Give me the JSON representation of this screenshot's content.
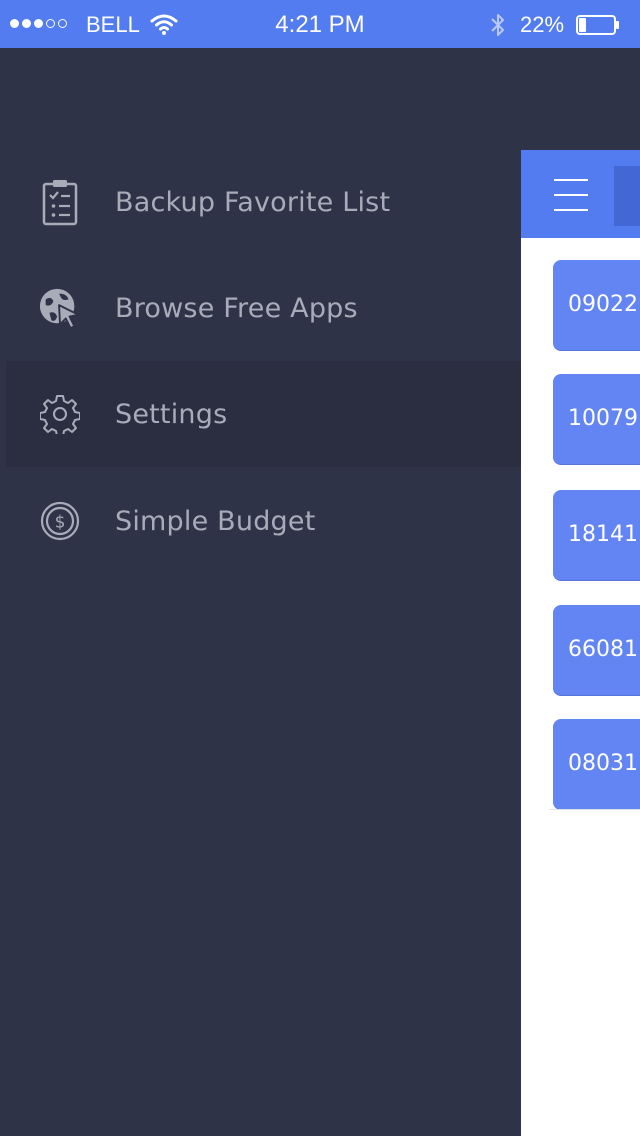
{
  "status_bar": {
    "signal_strength": 3,
    "signal_max": 5,
    "carrier": "BELL",
    "time": "4:21 PM",
    "battery_percent_label": "22%",
    "battery_level": 0.22
  },
  "menu": {
    "items": [
      {
        "label": "Backup Favorite List",
        "icon": "clipboard-checklist-icon",
        "active": false
      },
      {
        "label": "Browse Free Apps",
        "icon": "globe-cursor-icon",
        "active": false
      },
      {
        "label": "Settings",
        "icon": "gear-icon",
        "active": true
      },
      {
        "label": "Simple Budget",
        "icon": "dollar-coin-icon",
        "active": false
      }
    ]
  },
  "main": {
    "entries": [
      "09022",
      "10079",
      "18141",
      "66081",
      "08031"
    ]
  },
  "colors": {
    "accent": "#527cf0",
    "menu_background": "#2e3347",
    "menu_active": "#2a2e40",
    "menu_text": "#a8acb9",
    "card": "#6285f3"
  }
}
